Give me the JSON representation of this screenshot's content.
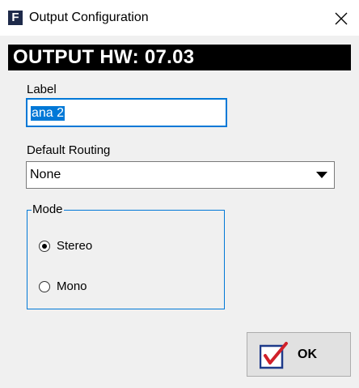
{
  "window": {
    "app_icon_letter": "F",
    "title": "Output Configuration",
    "close_glyph": "×"
  },
  "header": {
    "title": "OUTPUT HW: 07.03"
  },
  "label_field": {
    "caption": "Label",
    "value": "ana 2"
  },
  "routing": {
    "caption": "Default Routing",
    "selected": "None"
  },
  "mode": {
    "legend": "Mode",
    "options": [
      {
        "label": "Stereo",
        "selected": true
      },
      {
        "label": "Mono",
        "selected": false
      }
    ]
  },
  "ok_button": {
    "label": "OK",
    "icon": "checkbox-check-icon"
  },
  "colors": {
    "accent": "#0078d7",
    "header_bg": "#000000",
    "check_red": "#d0202a"
  }
}
